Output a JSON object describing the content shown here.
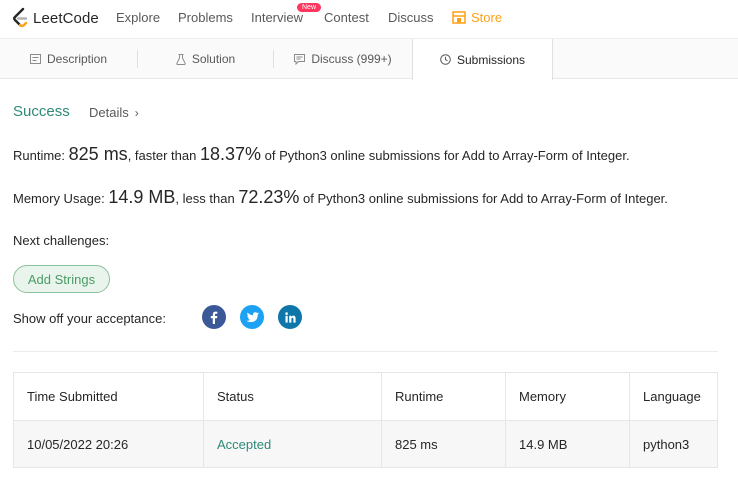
{
  "nav": {
    "logo_text": "LeetCode",
    "items": [
      "Explore",
      "Problems",
      "Interview",
      "Contest",
      "Discuss"
    ],
    "new_badge": "New",
    "store": "Store",
    "accent_color": "#ffa116"
  },
  "tabs": [
    {
      "label": "Description",
      "icon": "description-icon"
    },
    {
      "label": "Solution",
      "icon": "flask-icon"
    },
    {
      "label": "Discuss (999+)",
      "icon": "comment-icon"
    },
    {
      "label": "Submissions",
      "icon": "clock-icon",
      "active": true
    }
  ],
  "result": {
    "status": "Success",
    "details": "Details",
    "details_chevron": "›"
  },
  "runtime": {
    "label": "Runtime:",
    "value": "825 ms",
    "mid": ", faster than",
    "percent": "18.37%",
    "suffix": "of Python3 online submissions for Add to Array-Form of Integer."
  },
  "memory": {
    "label": "Memory Usage:",
    "value": "14.9 MB",
    "mid": ", less than",
    "percent": "72.23%",
    "suffix": "of Python3 online submissions for Add to Array-Form of Integer."
  },
  "next": {
    "label": "Next challenges:",
    "challenges": [
      "Add Strings"
    ]
  },
  "share": {
    "label": "Show off your acceptance:",
    "networks": [
      {
        "icon": "facebook-icon",
        "glyph": "f",
        "color": "#3b5998"
      },
      {
        "icon": "twitter-icon",
        "glyph": "t",
        "color": "#1da1f2"
      },
      {
        "icon": "linkedin-icon",
        "glyph": "in",
        "color": "#0e76a8"
      }
    ]
  },
  "table": {
    "headers": [
      "Time Submitted",
      "Status",
      "Runtime",
      "Memory",
      "Language"
    ],
    "rows": [
      [
        "10/05/2022 20:26",
        "Accepted",
        "825 ms",
        "14.9 MB",
        "python3"
      ]
    ]
  }
}
